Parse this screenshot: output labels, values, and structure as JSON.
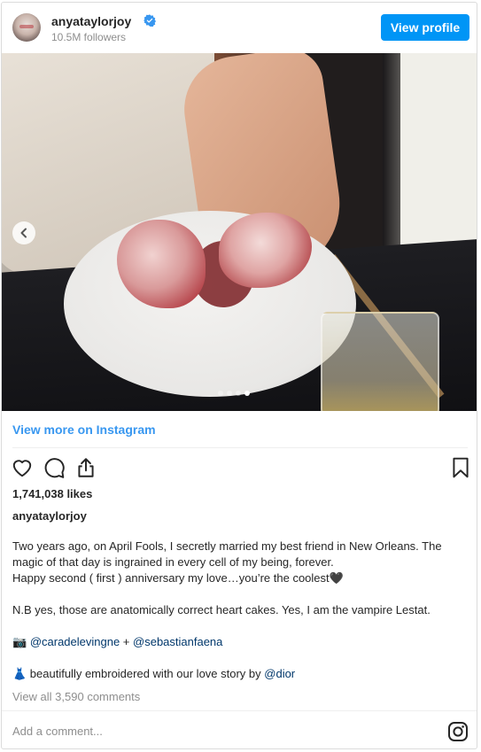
{
  "header": {
    "username": "anyataylorjoy",
    "followers": "10.5M followers",
    "view_profile_label": "View profile"
  },
  "carousel": {
    "slide_count": 4,
    "active_index": 3
  },
  "view_more_label": "View more on Instagram",
  "likes": "1,741,038 likes",
  "caption": {
    "username": "anyataylorjoy",
    "line1": "Two years ago, on April Fools, I secretly married my best friend in New Orleans. The magic of that day is ingrained in every cell of my being, forever.",
    "line2": "Happy second ( first ) anniversary my love…you’re the coolest🖤",
    "line3": "N.B yes, those are anatomically correct heart cakes. Yes, I am the vampire Lestat.",
    "camera_emoji": "📷",
    "mention1": "@caradelevingne",
    "plus": " + ",
    "mention2": "@sebastianfaena",
    "dress_emoji": "👗",
    "dress_text": " beautifully embroidered with our love story by ",
    "mention3": "@dior"
  },
  "comments_label": "View all 3,590 comments",
  "add_comment_placeholder": "Add a comment...",
  "colors": {
    "accent": "#0095f6",
    "link": "#3897f0",
    "verified": "#3897f0",
    "muted": "#8e8e8e",
    "text": "#262626"
  },
  "icons": [
    "verified-badge-icon",
    "chevron-left-icon",
    "heart-icon",
    "comment-icon",
    "share-icon",
    "bookmark-icon",
    "instagram-icon"
  ]
}
